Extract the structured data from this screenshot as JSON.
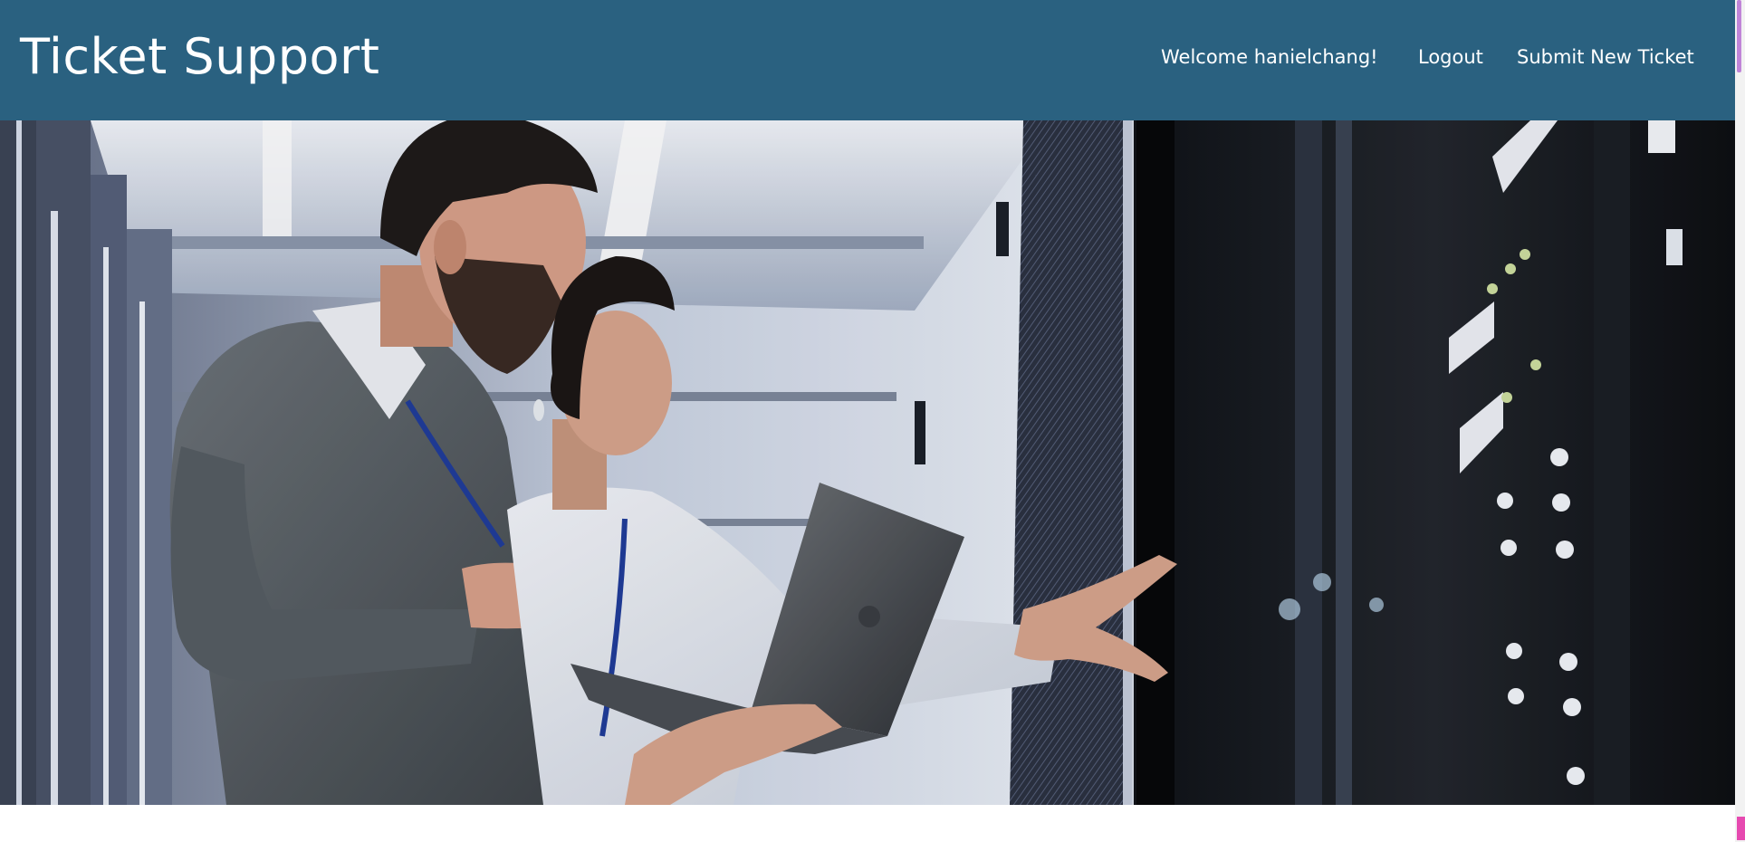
{
  "navbar": {
    "brand": "Ticket Support",
    "welcome": "Welcome hanielchang!",
    "logout": "Logout",
    "submit_new_ticket": "Submit New Ticket",
    "background_color": "#2a6180",
    "text_color": "#ffffff"
  },
  "hero": {
    "image_subject": "hero-photo"
  }
}
